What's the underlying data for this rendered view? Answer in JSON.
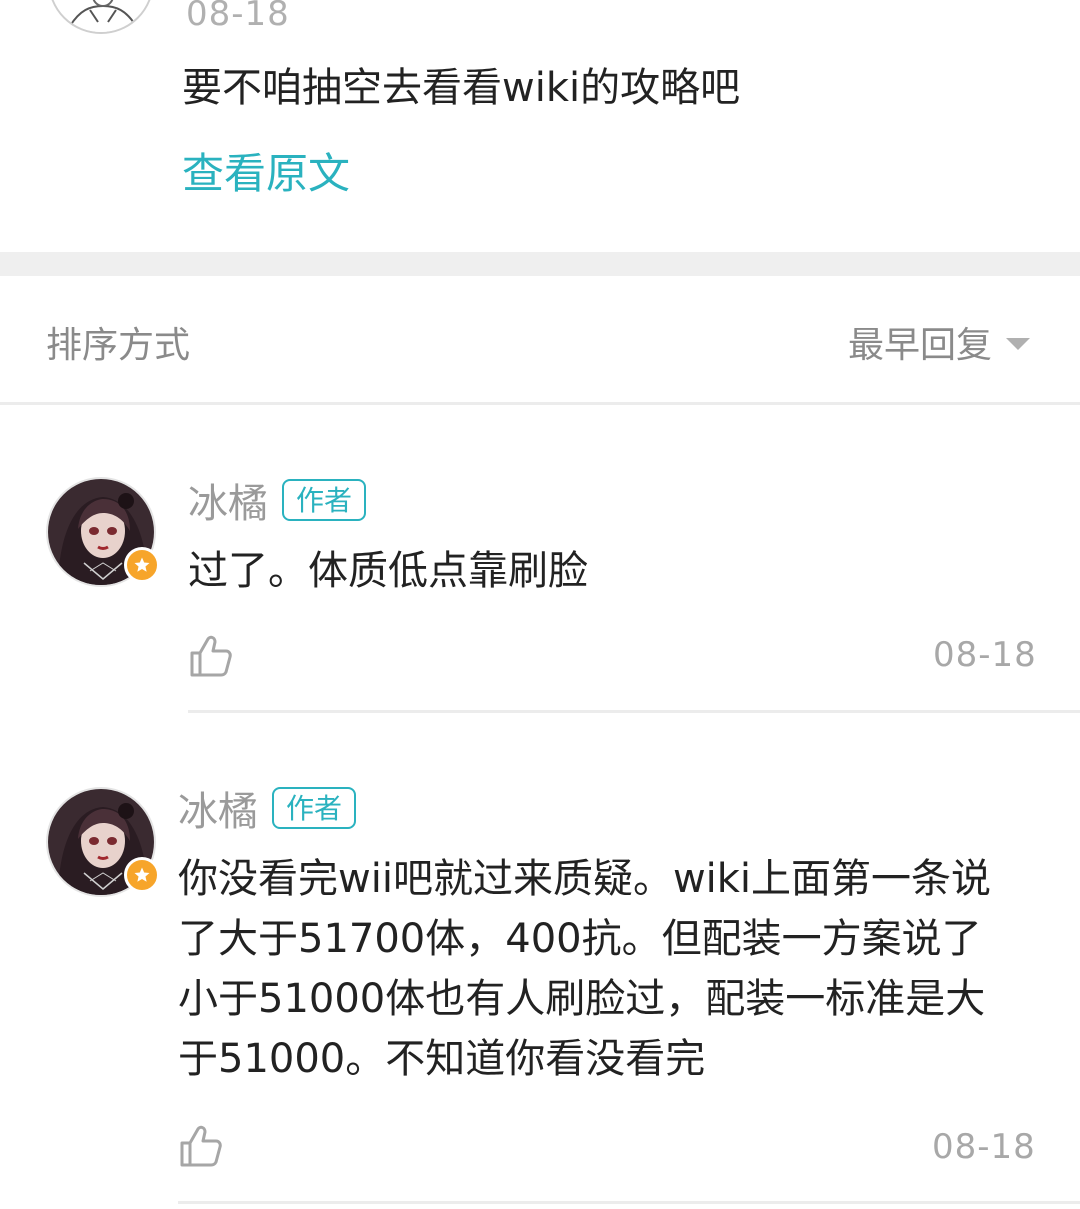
{
  "post": {
    "date": "08-18",
    "text": "要不咱抽空去看看wiki的攻略吧",
    "view_original": "查看原文"
  },
  "sort": {
    "label": "排序方式",
    "value": "最早回复"
  },
  "replies": [
    {
      "username": "冰橘",
      "tag": "作者",
      "text": "过了。体质低点靠刷脸",
      "date": "08-18"
    },
    {
      "username": "冰橘",
      "tag": "作者",
      "text_lines": [
        "你没看完wii吧就过来质疑。wiki上面第一条说",
        "了大于51700体，400抗。但配装一方案说了",
        "小于51000体也有人刷脸过，配装一标准是大",
        "于51000。不知道你看没看完"
      ],
      "date": "08-18"
    }
  ],
  "colors": {
    "accent": "#2ab2bf",
    "badge": "#f7a52a",
    "muted_text": "#8a8a8a",
    "body_text": "#222222",
    "divider": "#ececec"
  },
  "icons": {
    "like": "thumbs-up-icon",
    "sort_dropdown": "caret-down-icon",
    "badge": "star-icon"
  }
}
